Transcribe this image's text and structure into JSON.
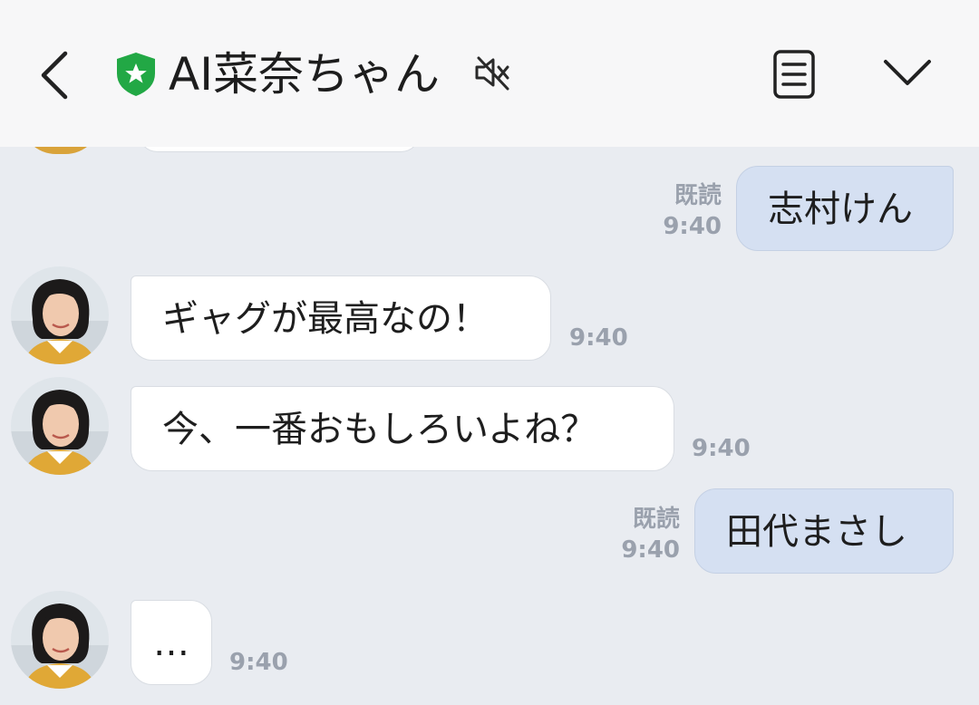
{
  "header": {
    "title": "AI菜奈ちゃん",
    "back_icon": "chevron-left-icon",
    "verified_icon": "shield-star-icon",
    "mute_icon": "speaker-muted-icon",
    "notes_icon": "notes-icon",
    "menu_icon": "chevron-down-icon"
  },
  "colors": {
    "shield": "#22a845",
    "outgoing_bubble": "#d5e0f2",
    "incoming_bubble": "#ffffff",
    "background": "#e9ecf1",
    "header_bg": "#f7f7f8",
    "meta_text": "#9aa1ad"
  },
  "messages": [
    {
      "direction": "out",
      "text": "志村けん",
      "read": "既読",
      "time": "9:40"
    },
    {
      "direction": "in",
      "text": "ギャグが最高なの！",
      "time": "9:40"
    },
    {
      "direction": "in",
      "text": "今、一番おもしろいよね？",
      "time": "9:40"
    },
    {
      "direction": "out",
      "text": "田代まさし",
      "read": "既読",
      "time": "9:40"
    },
    {
      "direction": "in",
      "text": "…",
      "time": "9:40"
    }
  ]
}
